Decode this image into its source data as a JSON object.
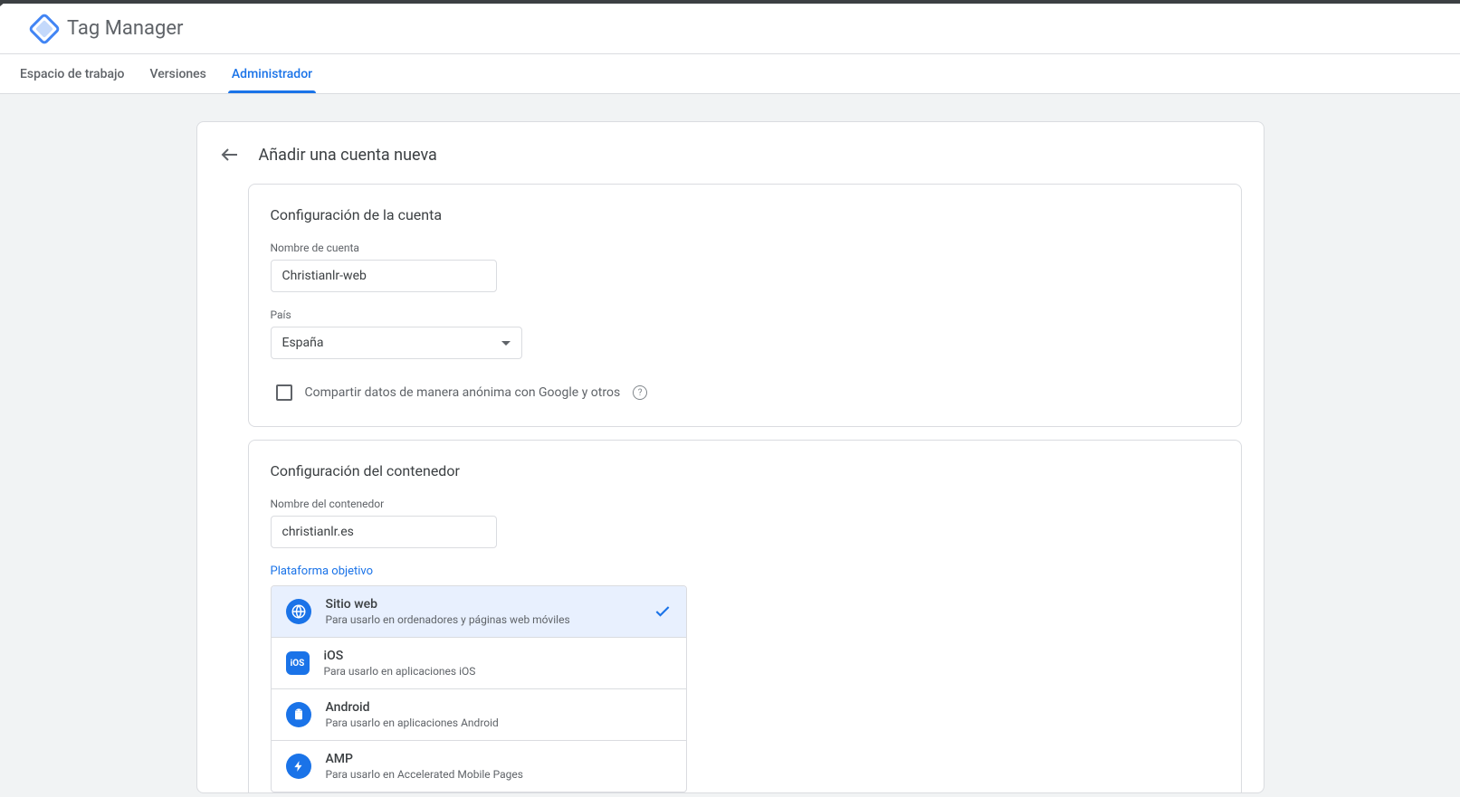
{
  "app_title": "Tag Manager",
  "tabs": {
    "workspace": "Espacio de trabajo",
    "versions": "Versiones",
    "admin": "Administrador"
  },
  "page_title": "Añadir una cuenta nueva",
  "account_section": {
    "title": "Configuración de la cuenta",
    "name_label": "Nombre de cuenta",
    "name_value": "Christianlr-web",
    "country_label": "País",
    "country_value": "España",
    "share_label": "Compartir datos de manera anónima con Google y otros"
  },
  "container_section": {
    "title": "Configuración del contenedor",
    "name_label": "Nombre del contenedor",
    "name_value": "christianlr.es",
    "platform_label": "Plataforma objetivo",
    "platforms": [
      {
        "title": "Sitio web",
        "desc": "Para usarlo en ordenadores y páginas web móviles",
        "selected": true
      },
      {
        "title": "iOS",
        "desc": "Para usarlo en aplicaciones iOS",
        "selected": false
      },
      {
        "title": "Android",
        "desc": "Para usarlo en aplicaciones Android",
        "selected": false
      },
      {
        "title": "AMP",
        "desc": "Para usarlo en Accelerated Mobile Pages",
        "selected": false
      }
    ]
  }
}
